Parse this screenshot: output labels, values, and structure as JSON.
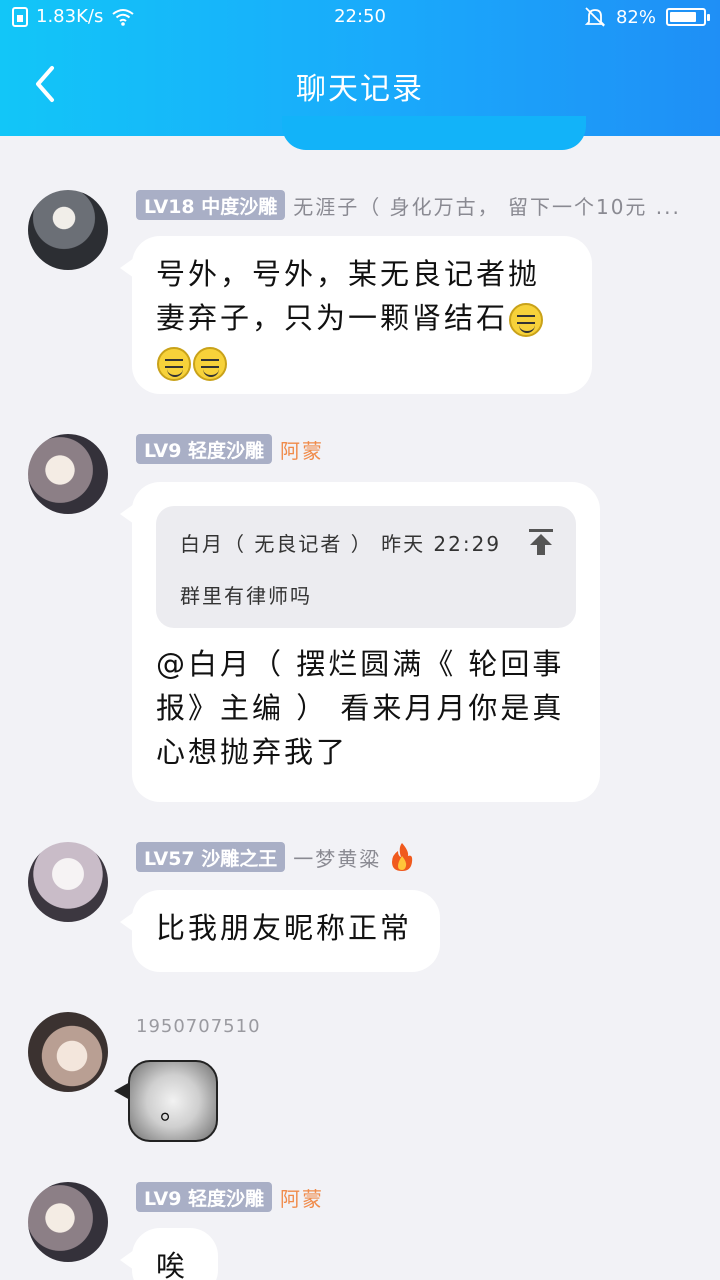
{
  "status_bar": {
    "network_speed": "1.83K/s",
    "time": "22:50",
    "battery": "82%",
    "battery_level": 0.82
  },
  "header": {
    "title": "聊天记录"
  },
  "messages": [
    {
      "badge": "LV18 中度沙雕",
      "name": "无涯子（ 身化万古， 留下一个10元 ...",
      "text_line1": "号外，号外，某无良记者抛",
      "text_line2": "妻弃子，只为一颗肾结石",
      "emoji": "smirk-emoji"
    },
    {
      "badge": "LV9 轻度沙雕",
      "name": "阿蒙",
      "quote_header": "白月（ 无良记者 ） 昨天 22:29",
      "quote_body": "群里有律师吗",
      "text_line1": "@白月（ 摆烂圆满《 轮回事",
      "text_line2": "报》主编 ） 看来月月你是真",
      "text_line3": "心想抛弃我了"
    },
    {
      "badge": "LV57 沙雕之王",
      "name": "一梦黄粱",
      "text": "比我朋友昵称正常"
    },
    {
      "uid": "1950707510",
      "text": "。"
    },
    {
      "badge": "LV9 轻度沙雕",
      "name": "阿蒙",
      "text": "唉"
    }
  ],
  "colors": {
    "header_start": "#12c6f8",
    "header_end": "#1f8ff6",
    "badge_bg": "#a9afc6",
    "name_orange": "#f08b4a",
    "page_bg": "#f2f2f6"
  }
}
